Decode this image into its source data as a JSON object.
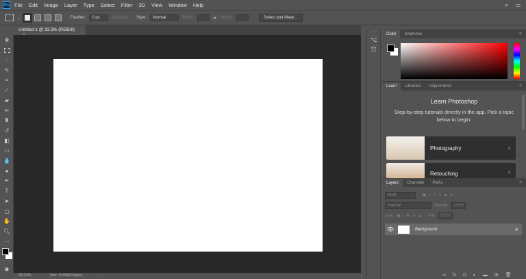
{
  "app": {
    "logo": "Ps"
  },
  "menu": [
    "File",
    "Edit",
    "Image",
    "Layer",
    "Type",
    "Select",
    "Filter",
    "3D",
    "View",
    "Window",
    "Help"
  ],
  "options": {
    "feather_label": "Feather:",
    "feather_value": "0 px",
    "antialias": "Anti-alias",
    "style_label": "Style:",
    "style_value": "Normal",
    "width_label": "Width:",
    "height_label": "Height:",
    "select_mask": "Select and Mask..."
  },
  "document_tab": {
    "title": "Untitled-1 @ 33.3% (RGB/8)",
    "close": "×"
  },
  "status": {
    "zoom": "33.33%",
    "doc": "Doc: 9.03M/0 bytes",
    "arrow": "›"
  },
  "color_panel": {
    "tabs": [
      "Color",
      "Swatches"
    ],
    "foreground": "#000000",
    "background": "#ffffff",
    "hue": "#ff0000"
  },
  "learn_panel": {
    "tabs": [
      "Learn",
      "Libraries",
      "Adjustments"
    ],
    "title": "Learn Photoshop",
    "subtitle": "Step-by-step tutorials directly in the app. Pick a topic below to begin.",
    "cards": [
      "Photography",
      "Retouching"
    ]
  },
  "layers_panel": {
    "tabs": [
      "Layers",
      "Channels",
      "Paths"
    ],
    "kind_placeholder": "Kind",
    "blend_mode": "Normal",
    "opacity_label": "Opacity:",
    "opacity_value": "100%",
    "lock_label": "Lock:",
    "fill_label": "Fill:",
    "fill_value": "100%",
    "layers": [
      {
        "name": "Background",
        "visible": true,
        "locked": true
      }
    ]
  }
}
